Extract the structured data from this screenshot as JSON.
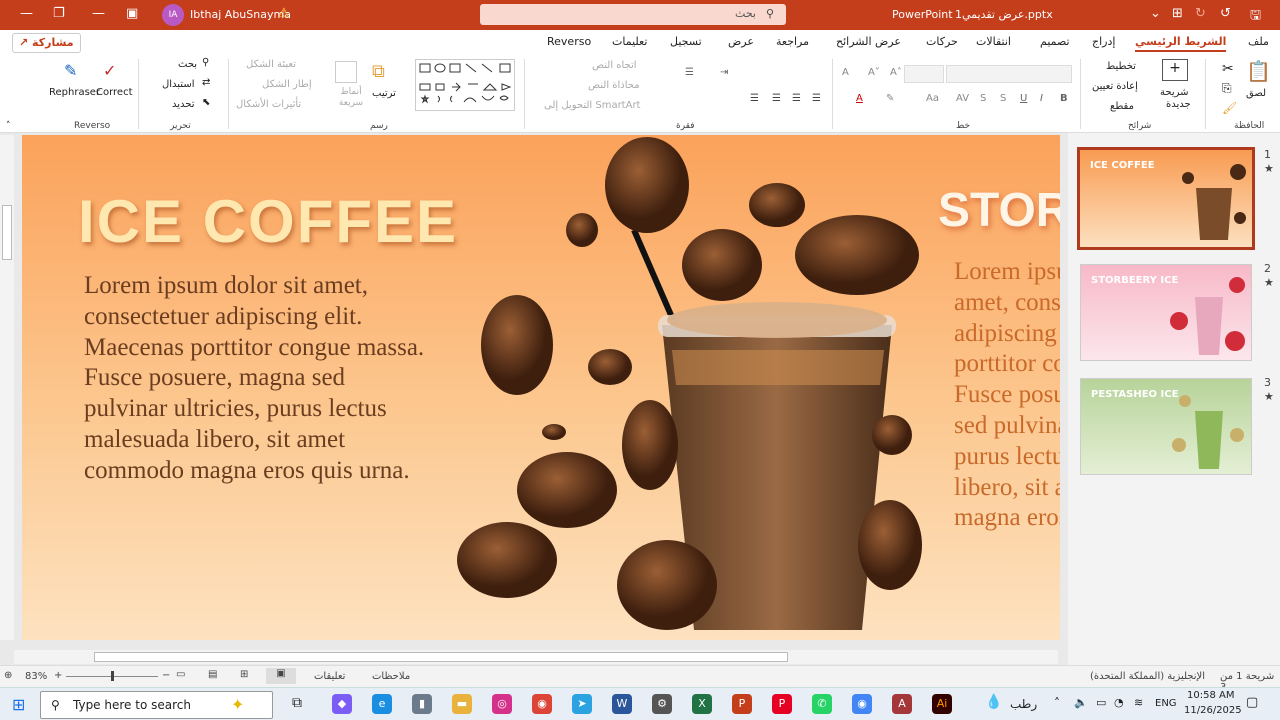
{
  "titlebar": {
    "user_initials": "IA",
    "user_name": "Ibthaj AbuSnayma",
    "search_placeholder": "بحث",
    "app_name": "PowerPoint",
    "doc_name": "عرض تقديمي1.pptx"
  },
  "tabs": {
    "share": "مشاركة",
    "items": [
      "Reverso",
      "تعليمات",
      "تسجيل",
      "عرض",
      "مراجعة",
      "عرض الشرائح",
      "حركات",
      "انتقالات",
      "تصميم",
      "إدراج",
      "الشريط الرئيسي",
      "ملف"
    ],
    "active_index": 10
  },
  "ribbon": {
    "reverso": {
      "rephraser": "Rephraser",
      "correct": "Correct",
      "group": "Reverso"
    },
    "edit": {
      "find": "بحث",
      "replace": "استبدال",
      "select": "تحديد",
      "group": "تحرير"
    },
    "drawing": {
      "fill": "تعبئة الشكل",
      "outline": "إطار الشكل",
      "effects": "تأثيرات الأشكال",
      "quick_styles": "أنماط سريعة",
      "arrange": "ترتيب",
      "group": "رسم"
    },
    "paragraph": {
      "text_direction": "اتجاه النص",
      "align_text": "محاذاة النص",
      "smartart": "التحويل إلى SmartArt",
      "group": "فقرة"
    },
    "font": {
      "group": "خط"
    },
    "slides": {
      "new_slide_l1": "شريحة",
      "new_slide_l2": "جديدة",
      "layout": "تخطيط",
      "reset": "إعادة تعيين",
      "section": "مقطع",
      "group": "شرائح"
    },
    "clipboard": {
      "paste": "لصق",
      "group": "الحافظة"
    }
  },
  "slide": {
    "title": "ICE COFFEE",
    "body": "Lorem ipsum dolor sit amet, consectetuer adipiscing elit. Maecenas porttitor congue massa. Fusce posuere, magna sed pulvinar ultricies, purus lectus malesuada libero, sit amet commodo magna eros quis urna.",
    "next_title": "STOR",
    "next_body": "Lorem ipsum dolor sit amet, consectetuer adipiscing elit. Maecenas porttitor congue massa. Fusce posuere, magna sed pulvinar ultricies, purus lectus malesuada libero, sit amet commodo magna eros quis urna."
  },
  "thumbnails": [
    {
      "num": "1",
      "title": "ICE COFFEE",
      "bg": "#fbb06a"
    },
    {
      "num": "2",
      "title": "STORBEERY ICE",
      "bg": "#f9cfd8"
    },
    {
      "num": "3",
      "title": "PESTASHEO ICE",
      "bg": "#c9deb0"
    }
  ],
  "status": {
    "slide_info": "شريحة 1 من 3",
    "language": "الإنجليزية (المملكة المتحدة)",
    "notes": "ملاحظات",
    "comments": "تعليقات",
    "zoom": "83%"
  },
  "taskbar": {
    "search_placeholder": "Type here to search",
    "weather": "رطب",
    "lang": "ENG",
    "time": "10:58 AM",
    "date": "11/26/2025"
  }
}
